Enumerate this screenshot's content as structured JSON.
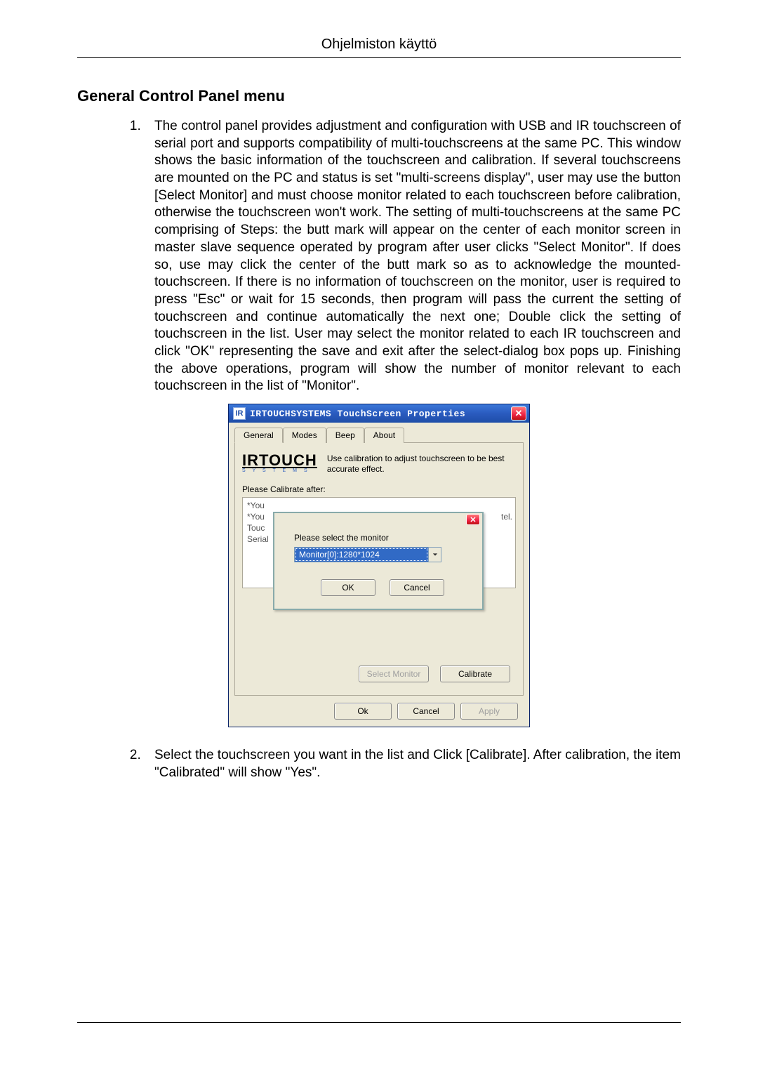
{
  "page_header": "Ohjelmiston käyttö",
  "section_title": "General Control Panel menu",
  "steps": {
    "s1": "The control panel provides adjustment and configuration with USB and IR touchscreen of serial port and supports compatibility of multi-touchscreens at the same PC. This window shows the basic information of the touchscreen and calibration. If several touchscreens are mounted on the PC and status is set \"multi-screens display\", user may use the button [Select Monitor] and must choose monitor related to each touchscreen before calibration, otherwise the touchscreen won't work. The setting of multi-touchscreens at the same PC comprising of Steps: the butt mark will appear on the center of each monitor screen in master slave sequence operated by program after user clicks \"Select Monitor\". If does so, use may click the center of the butt mark so as to acknowledge the mounted-touchscreen. If there is no information of touchscreen on the monitor, user is required to press \"Esc\" or wait for 15 seconds, then program will pass the current the setting of touchscreen and continue automatically the next one; Double click the setting of touchscreen in the list. User may select the monitor related to each IR touchscreen and click \"OK\" representing the save and exit after the select-dialog box pops up. Finishing the above operations, program will show the number of monitor relevant to each touchscreen in the list of \"Monitor\".",
    "s2": "Select the touchscreen you want in the list and Click [Calibrate]. After calibration, the item \"Calibrated\" will show \"Yes\"."
  },
  "dialog": {
    "app_icon": "IR",
    "title": "IRTOUCHSYSTEMS TouchScreen Properties",
    "tabs": {
      "general": "General",
      "modes": "Modes",
      "beep": "Beep",
      "about": "About"
    },
    "brand": "IRTOUCH",
    "brand_sub": "S Y S T E M S",
    "desc": "Use calibration to adjust touchscreen to be best accurate effect.",
    "calibrate_after": "Please Calibrate after:",
    "list_rows": {
      "r1": "*You",
      "r2": "*You",
      "r3": "Touc",
      "r4": "Serial"
    },
    "truncated_right": "tel.",
    "select_monitor_btn": "Select Monitor",
    "calibrate_btn": "Calibrate",
    "bottom": {
      "ok": "Ok",
      "cancel": "Cancel",
      "apply": "Apply"
    },
    "inner": {
      "prompt": "Please select the monitor",
      "combo_value": "Monitor[0]:1280*1024",
      "ok": "OK",
      "cancel": "Cancel"
    }
  }
}
